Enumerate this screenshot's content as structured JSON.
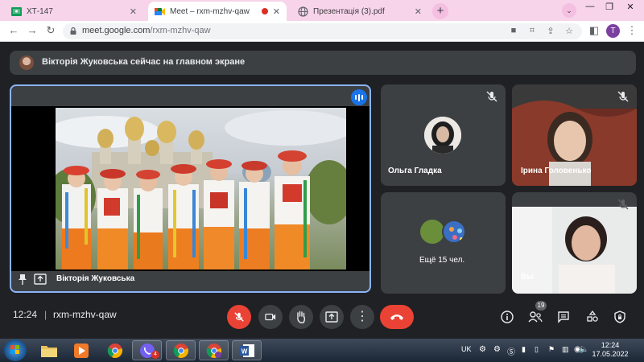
{
  "browser": {
    "tabs": [
      {
        "label": "ХТ-147",
        "active": false
      },
      {
        "label": "Meet – rxm-mzhv-qaw",
        "active": true,
        "recording": true
      },
      {
        "label": "Презентація (3).pdf",
        "active": false
      }
    ],
    "new_tab": "+",
    "url_host": "meet.google.com",
    "url_path": "/rxm-mzhv-qaw",
    "profile_initial": "T"
  },
  "meet": {
    "banner_text": "Вікторія Жуковська сейчас на главном экране",
    "presenter_name": "Вікторія Жуковська",
    "participants": [
      {
        "name": "Ольга Гладка"
      },
      {
        "name": "Ірина Головенько"
      },
      {
        "name": "Ещё 15 чел."
      },
      {
        "name": "Вы"
      }
    ],
    "time": "12:24",
    "separator": "|",
    "meeting_code": "rxm-mzhv-qaw",
    "people_count": "19"
  },
  "taskbar": {
    "language": "UK",
    "clock_time": "12:24",
    "clock_date": "17.05.2022",
    "viber_badge": "4"
  },
  "colors": {
    "accent_blue": "#8ab4f8",
    "end_call_red": "#ea4335",
    "tab_strip_pink": "#f8d4ea",
    "meet_bg": "#202124"
  }
}
